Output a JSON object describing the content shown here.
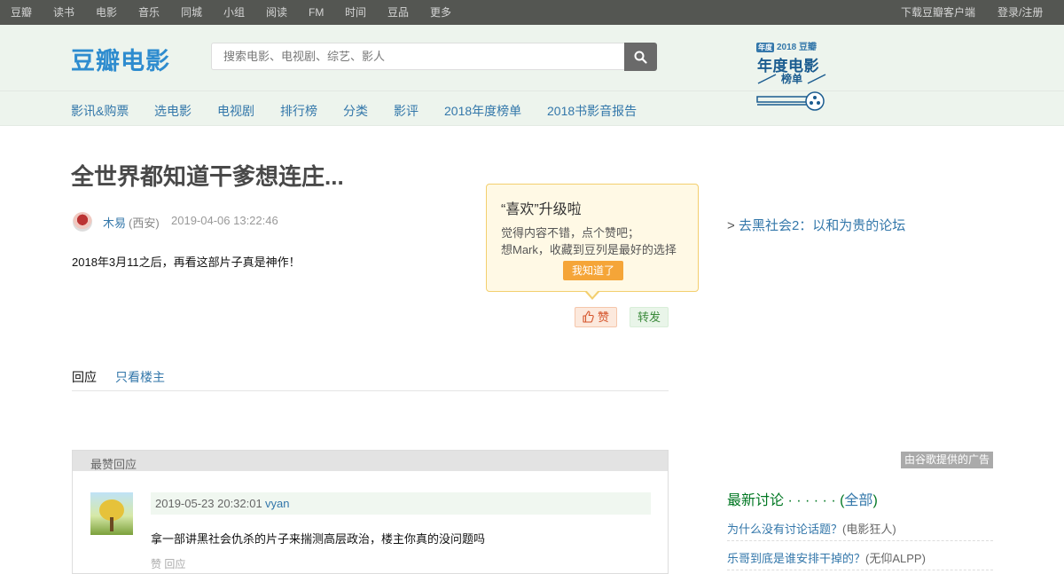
{
  "global_nav": {
    "left": [
      "豆瓣",
      "读书",
      "电影",
      "音乐",
      "同城",
      "小组",
      "阅读",
      "FM",
      "时间",
      "豆品",
      "更多"
    ],
    "right": [
      "下载豆瓣客户端",
      "登录/注册"
    ]
  },
  "header": {
    "logo": "豆瓣电影",
    "search_placeholder": "搜索电影、电视剧、综艺、影人",
    "search_icon": "magnifier-icon",
    "subnav": [
      "影讯&购票",
      "选电影",
      "电视剧",
      "排行榜",
      "分类",
      "影评",
      "2018年度榜单",
      "2018书影音报告"
    ],
    "badge": {
      "tag": "年度",
      "top": "2018 豆瓣",
      "main": "年度电影",
      "sub": "榜单"
    }
  },
  "post": {
    "title": "全世界都知道干爹想连庄...",
    "author": "木易",
    "location": "(西安)",
    "time": "2019-04-06 13:22:46",
    "body": "2018年3月11之后，再看这部片子真是神作！"
  },
  "tooltip": {
    "title": "“喜欢”升级啦",
    "line1": "觉得内容不错，点个赞吧；",
    "line2": "想Mark，收藏到豆列是最好的选择",
    "button": "我知道了"
  },
  "actions": {
    "like": "赞",
    "share": "转发"
  },
  "tabs": [
    "回应",
    "只看楼主"
  ],
  "best_replies": {
    "heading": "最赞回应",
    "reply": {
      "time": "2019-05-23 20:32:01",
      "user": "vyan",
      "text": "拿一部讲黑社会仇杀的片子来揣测高层政治，楼主你真的没问题吗",
      "extra": "赞   回应"
    }
  },
  "sidebar": {
    "back_arrow": ">",
    "back_link": "去黑社会2：以和为贵的论坛",
    "ad_label": "由谷歌提供的广告",
    "latest_heading": "最新讨论 · · · · · · (",
    "latest_all": "全部",
    "latest_close": ")",
    "discussions": [
      {
        "title": "为什么没有讨论话题？",
        "author": "(电影狂人)"
      },
      {
        "title": "乐哥到底是谁安排干掉的？",
        "author": "(无仰ALPP)"
      }
    ]
  },
  "colors": {
    "link": "#3377aa",
    "topbar": "#545652",
    "header_bg": "#edf4ed",
    "accent_green": "#007722"
  }
}
